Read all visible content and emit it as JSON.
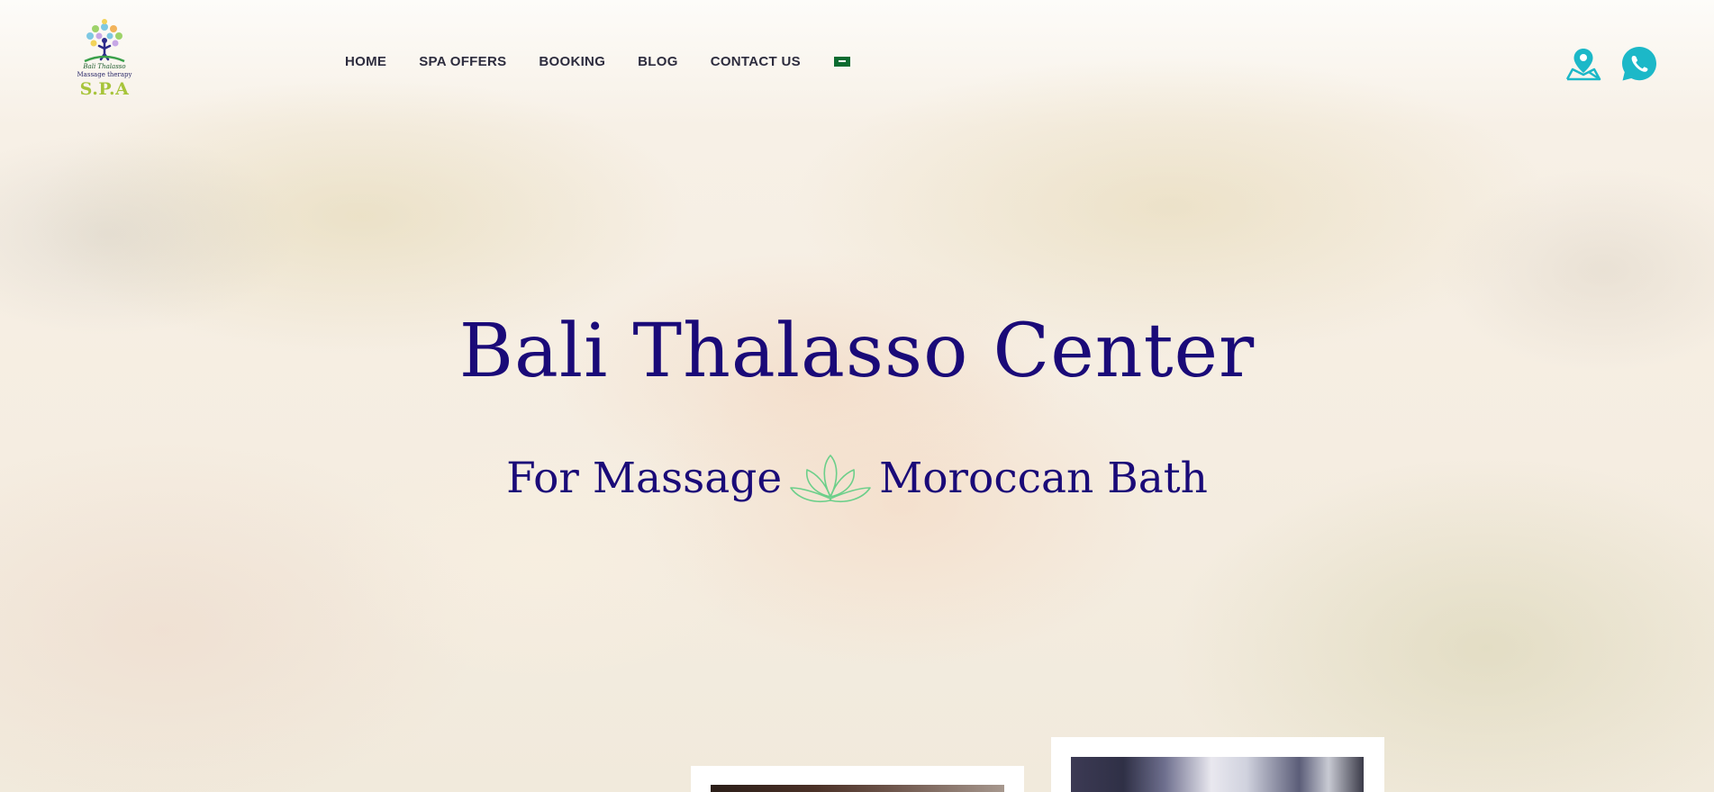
{
  "header": {
    "logo": {
      "line1": "Bali Thalasso",
      "line2": "Massage therapy",
      "line3": "S.P.A"
    },
    "nav": [
      {
        "label": "HOME"
      },
      {
        "label": "SPA OFFERS"
      },
      {
        "label": "BOOKING"
      },
      {
        "label": "BLOG"
      },
      {
        "label": "CONTACT US"
      }
    ],
    "language_flag": "saudi-arabia-flag-icon",
    "icons": {
      "map": "map-location-icon",
      "whatsapp": "whatsapp-icon"
    }
  },
  "hero": {
    "title": "Bali Thalasso Center",
    "subtitle_left": "For Massage",
    "subtitle_right": "Moroccan Bath",
    "divider_icon": "lotus-icon"
  },
  "colors": {
    "title": "#1a0a78",
    "nav_text": "#2d2c3e",
    "icon_accent": "#1cb8c8",
    "lotus": "#6ccf8a",
    "logo_green": "#a7c43a"
  }
}
